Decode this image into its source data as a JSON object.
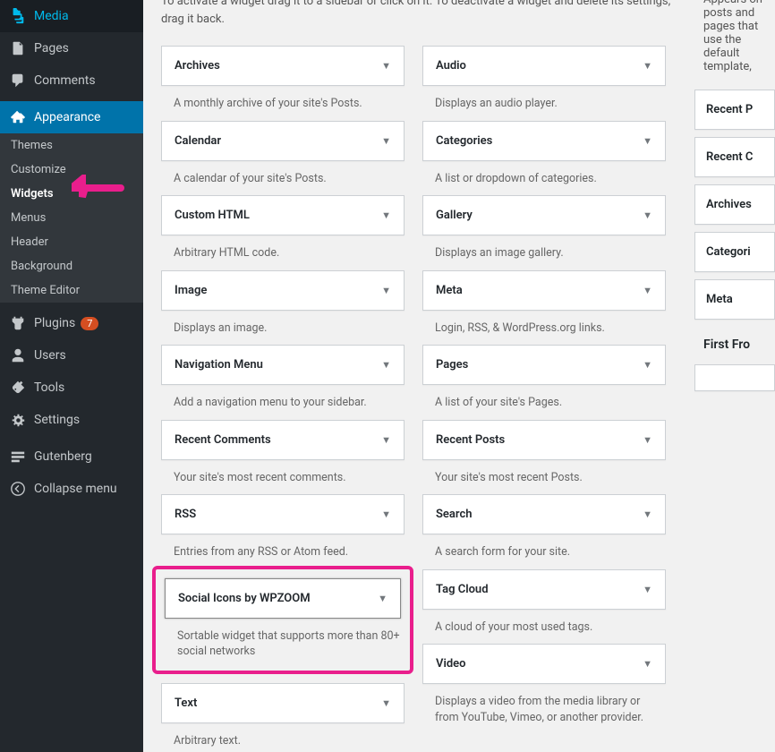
{
  "sidebar": {
    "items": [
      {
        "icon": "media-icon",
        "label": "Media"
      },
      {
        "icon": "page-icon",
        "label": "Pages"
      },
      {
        "icon": "comment-icon",
        "label": "Comments"
      }
    ],
    "appearance": {
      "label": "Appearance",
      "sub": [
        {
          "label": "Themes"
        },
        {
          "label": "Customize"
        },
        {
          "label": "Widgets",
          "current": true
        },
        {
          "label": "Menus"
        },
        {
          "label": "Header"
        },
        {
          "label": "Background"
        },
        {
          "label": "Theme Editor"
        }
      ]
    },
    "lower": [
      {
        "icon": "plugin-icon",
        "label": "Plugins",
        "badge": "7"
      },
      {
        "icon": "user-icon",
        "label": "Users"
      },
      {
        "icon": "tools-icon",
        "label": "Tools"
      },
      {
        "icon": "settings-icon",
        "label": "Settings"
      }
    ],
    "extra": [
      {
        "icon": "gutenberg-icon",
        "label": "Gutenberg"
      },
      {
        "icon": "collapse-icon",
        "label": "Collapse menu"
      }
    ]
  },
  "intro": "To activate a widget drag it to a sidebar or click on it. To deactivate a widget and delete its settings, drag it back.",
  "widgets": {
    "left": [
      {
        "title": "Archives",
        "desc": "A monthly archive of your site's Posts."
      },
      {
        "title": "Calendar",
        "desc": "A calendar of your site's Posts."
      },
      {
        "title": "Custom HTML",
        "desc": "Arbitrary HTML code."
      },
      {
        "title": "Image",
        "desc": "Displays an image."
      },
      {
        "title": "Navigation Menu",
        "desc": "Add a navigation menu to your sidebar."
      },
      {
        "title": "Recent Comments",
        "desc": "Your site's most recent comments."
      },
      {
        "title": "RSS",
        "desc": "Entries from any RSS or Atom feed."
      },
      {
        "title": "Social Icons by WPZOOM",
        "desc": "Sortable widget that supports more than 80+ social networks",
        "highlight": true
      },
      {
        "title": "Text",
        "desc": "Arbitrary text."
      }
    ],
    "right": [
      {
        "title": "Audio",
        "desc": "Displays an audio player."
      },
      {
        "title": "Categories",
        "desc": "A list or dropdown of categories."
      },
      {
        "title": "Gallery",
        "desc": "Displays an image gallery."
      },
      {
        "title": "Meta",
        "desc": "Login, RSS, & WordPress.org links."
      },
      {
        "title": "Pages",
        "desc": "A list of your site's Pages."
      },
      {
        "title": "Recent Posts",
        "desc": "Your site's most recent Posts."
      },
      {
        "title": "Search",
        "desc": "A search form for your site."
      },
      {
        "title": "Tag Cloud",
        "desc": "A cloud of your most used tags."
      },
      {
        "title": "Video",
        "desc": "Displays a video from the media library or from YouTube, Vimeo, or another provider."
      }
    ]
  },
  "right_panel": {
    "desc": "Appears on posts and pages that use the default template, ",
    "areas": [
      {
        "label": "Recent P"
      },
      {
        "label": "Recent C"
      },
      {
        "label": "Archives"
      },
      {
        "label": "Categori"
      },
      {
        "label": "Meta"
      }
    ],
    "section_title": "First Fro"
  }
}
